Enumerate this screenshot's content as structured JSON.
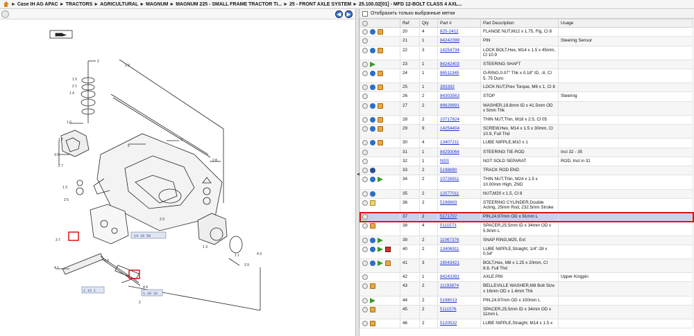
{
  "breadcrumb": [
    "Case IH AG APAC",
    "TRACTORS",
    "AGRICULTURAL",
    "MAGNUM",
    "MAGNUM 225 - SMALL FRAME TRACTOR TI...",
    "25 - FRONT AXLE SYSTEM",
    "25.100.02[01] - MFD 12-BOLT CLASS 4 AXL..."
  ],
  "breadcrumb_sep": "►",
  "filter": {
    "label": "Отобразить только выбранные метки",
    "checked": false
  },
  "nav": {
    "prev": "◀",
    "next": "▶"
  },
  "drawing": {
    "callout_labels": [
      "14 29 59",
      "1 15 1",
      "1 18 33"
    ]
  },
  "columns": [
    "",
    "Ref",
    "Qty",
    "Part #",
    "Part Description",
    "Usage"
  ],
  "rows": [
    {
      "icons": [
        "circle",
        "info",
        "box"
      ],
      "ref": "20",
      "qty": "4",
      "part": "825-2412",
      "desc": "FLANGE NUT,M12 x 1.75, Flg, Cl 8",
      "usage": ""
    },
    {
      "icons": [
        "circle"
      ],
      "ref": "21",
      "qty": "1",
      "part": "84242399",
      "desc": "PIN",
      "usage": "Steering Sensor"
    },
    {
      "icons": [
        "circle",
        "info",
        "box"
      ],
      "ref": "22",
      "qty": "3",
      "part": "14254734",
      "desc": "LOCK BOLT,Hex, M14 x 1.5 x 45mm, Cl 10.9",
      "usage": ""
    },
    {
      "icons": [
        "circle",
        "arrow"
      ],
      "ref": "23",
      "qty": "1",
      "part": "84242403",
      "desc": "STEERING SHAFT",
      "usage": ""
    },
    {
      "icons": [
        "circle",
        "info",
        "box"
      ],
      "ref": "24",
      "qty": "1",
      "part": "86511345",
      "desc": "O-RING,0.07\" Thk x 0.18\" ID, -8, Cl 5, 75 Duro",
      "usage": ""
    },
    {
      "icons": [
        "circle",
        "info",
        "box"
      ],
      "ref": "25",
      "qty": "1",
      "part": "393392",
      "desc": "LOCK NUT,Prev Torque, M6 x 1, Cl 8",
      "usage": ""
    },
    {
      "icons": [
        "circle"
      ],
      "ref": "26",
      "qty": "2",
      "part": "84303563",
      "desc": "STOP",
      "usage": "Steering"
    },
    {
      "icons": [
        "circle",
        "info",
        "box"
      ],
      "ref": "27",
      "qty": "2",
      "part": "86629891",
      "desc": "WASHER,19.8mm ID x 41.5mm OD x 5mm Thk",
      "usage": ""
    },
    {
      "icons": [
        "circle",
        "info",
        "box"
      ],
      "ref": "28",
      "qty": "2",
      "part": "10717624",
      "desc": "THIN NUT,Thin, M18 x 2.5, Cl 05",
      "usage": ""
    },
    {
      "icons": [
        "circle",
        "info",
        "box"
      ],
      "ref": "29",
      "qty": "9",
      "part": "14254404",
      "desc": "SCREW,Hex, M14 x 1.5 x 30mm, Cl 10.9, Full Thd",
      "usage": ""
    },
    {
      "icons": [
        "circle",
        "info",
        "box"
      ],
      "ref": "30",
      "qty": "4",
      "part": "13407211",
      "desc": "LUBE NIPPLE,M10 x 1",
      "usage": ""
    },
    {
      "icons": [
        "circle"
      ],
      "ref": "31",
      "qty": "1",
      "part": "84293064",
      "desc": "STEERING TIE-ROD",
      "usage": "Incl 32 - 35"
    },
    {
      "icons": [
        "circle"
      ],
      "ref": "32",
      "qty": "1",
      "part": "NSS",
      "desc": "NOT SOLD SEPARAT",
      "usage": "ROD, Incl in 31"
    },
    {
      "icons": [
        "circle",
        "gear"
      ],
      "ref": "33",
      "qty": "2",
      "part": "5198880",
      "desc": "TRACK ROD END",
      "usage": ""
    },
    {
      "icons": [
        "circle",
        "info",
        "arrow"
      ],
      "ref": "34",
      "qty": "2",
      "part": "10726911",
      "desc": "THIN NUT,Thin, M24 x 1.5 x 10.00mm High, ZND",
      "usage": ""
    },
    {
      "icons": [
        "circle",
        "info"
      ],
      "ref": "35",
      "qty": "2",
      "part": "12577011",
      "desc": "NUT,M20 x 1.5, Cl 8",
      "usage": ""
    },
    {
      "icons": [
        "circle",
        "doc"
      ],
      "ref": "36",
      "qty": "2",
      "part": "5198883",
      "desc": "STEERING CYLINDER,Double Acting, 25mm Rod, 232.5mm Stroke",
      "usage": ""
    },
    {
      "icons": [
        "circle"
      ],
      "ref": "37",
      "qty": "2",
      "part": "5171707",
      "desc": "PIN,24.97mm OD x 91mm L",
      "usage": "",
      "selected": true
    },
    {
      "icons": [
        "circle",
        "box"
      ],
      "ref": "38",
      "qty": "4",
      "part": "5111573",
      "desc": "SPACER,25.5mm ID x 34mm OD x 5.9mm L",
      "usage": ""
    },
    {
      "icons": [
        "circle",
        "info",
        "arrow"
      ],
      "ref": "39",
      "qty": "2",
      "part": "11067376",
      "desc": "SNAP RING,M25, Ext",
      "usage": ""
    },
    {
      "icons": [
        "circle",
        "info",
        "arrow",
        "note"
      ],
      "ref": "40",
      "qty": "2",
      "part": "13406911",
      "desc": "LUBE NIPPLE,Straight, 1/4\"-28 x 0.54\"",
      "usage": ""
    },
    {
      "icons": [
        "circle",
        "info",
        "arrow",
        "box"
      ],
      "ref": "41",
      "qty": "3",
      "part": "16043421",
      "desc": "BOLT,Hex, M8 x 1.25 x 20mm, Cl 8.8, Full Thd",
      "usage": ""
    },
    {
      "icons": [
        "circle"
      ],
      "ref": "42",
      "qty": "1",
      "part": "84243391",
      "desc": "AXLE PIN",
      "usage": "Upper Kingpin"
    },
    {
      "icons": [
        "circle",
        "box"
      ],
      "ref": "43",
      "qty": "2",
      "part": "11193874",
      "desc": "BELLEVILLE WASHER,M8 Bolt Size x 16mm OD x 1.4mm Thk",
      "usage": ""
    },
    {
      "icons": [
        "circle",
        "arrow"
      ],
      "ref": "44",
      "qty": "2",
      "part": "5198013",
      "desc": "PIN,24.97mm OD x 100mm L",
      "usage": ""
    },
    {
      "icons": [
        "circle",
        "box"
      ],
      "ref": "45",
      "qty": "2",
      "part": "5111576",
      "desc": "SPACER,25.5mm ID x 34mm OD x 11mm L",
      "usage": ""
    },
    {
      "icons": [
        "circle",
        "box"
      ],
      "ref": "46",
      "qty": "2",
      "part": "5120532",
      "desc": "LUBE NIPPLE,Straight, M14 x 1.5 x",
      "usage": ""
    }
  ]
}
